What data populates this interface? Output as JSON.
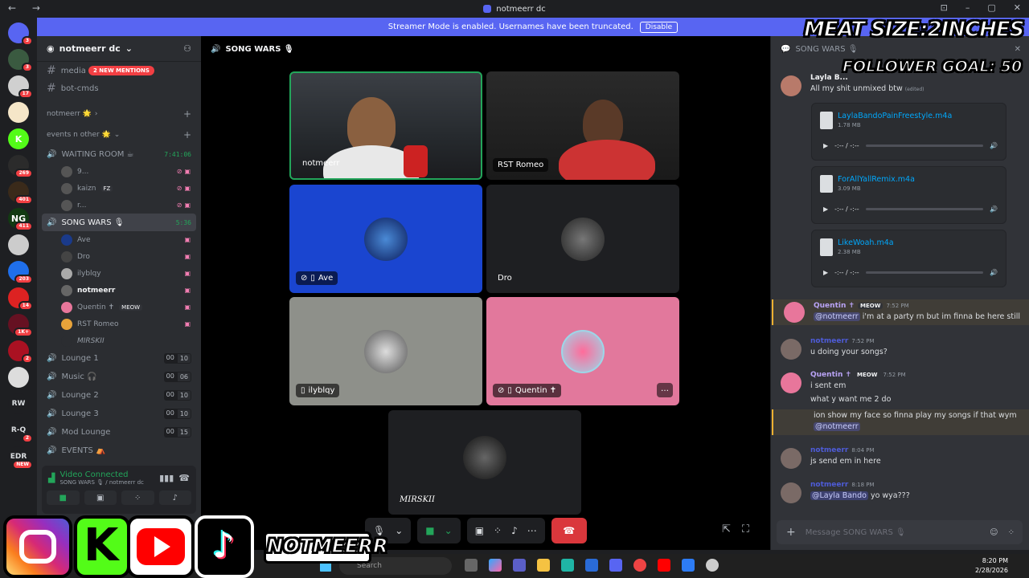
{
  "window": {
    "title": "notmeerr dc",
    "nav": "← →",
    "controls": [
      "⊡",
      "–",
      "▢",
      "✕"
    ]
  },
  "banner": {
    "text": "Streamer Mode is enabled. Usernames have been truncated.",
    "button": "Disable"
  },
  "servers": [
    {
      "label": "",
      "color": "#5865f2",
      "badge": "3"
    },
    {
      "label": "",
      "color": "#3a5a40",
      "badge": "3"
    },
    {
      "label": "",
      "color": "#d0d0d0",
      "badge": "17"
    },
    {
      "label": "",
      "color": "#f5e6c8",
      "badge": ""
    },
    {
      "label": "K",
      "color": "#53fc18",
      "badge": ""
    },
    {
      "label": "",
      "color": "#2b2b2b",
      "badge": "269"
    },
    {
      "label": "",
      "color": "#3a2a1a",
      "badge": "401"
    },
    {
      "label": "NG",
      "color": "#123a12",
      "badge": "411"
    },
    {
      "label": "",
      "color": "#cccccc",
      "badge": ""
    },
    {
      "label": "",
      "color": "#1f6feb",
      "badge": "203"
    },
    {
      "label": "",
      "color": "#d22",
      "badge": "14"
    },
    {
      "label": "",
      "color": "#612",
      "badge": "1K+"
    },
    {
      "label": "",
      "color": "#a12",
      "badge": "2"
    },
    {
      "label": "",
      "color": "#ddd",
      "badge": ""
    },
    {
      "label": "RW",
      "color": "#1e1f22",
      "badge": ""
    },
    {
      "label": "R-Q",
      "color": "#1e1f22",
      "badge": "2"
    },
    {
      "label": "EDR",
      "color": "#1e1f22",
      "badge": "NEW"
    }
  ],
  "guild": {
    "name": "notmeerr dc"
  },
  "channels": {
    "text": [
      {
        "name": "media"
      },
      {
        "name": "bot-cmds"
      }
    ],
    "mentions": "2 NEW MENTIONS",
    "cat1": "notmeerr 🌟",
    "cat2": "events n other 🌟",
    "waiting": {
      "name": "WAITING ROOM ☕",
      "time": "7:41:06"
    },
    "waiting_users": [
      {
        "name": "9...",
        "tag": ""
      },
      {
        "name": "kaizn",
        "tag": "FZ"
      },
      {
        "name": "r...",
        "tag": ""
      }
    ],
    "songwars": {
      "name": "SONG WARS 🎙",
      "time": "5:36"
    },
    "song_users": [
      {
        "name": "Ave",
        "tag": "",
        "color": "#1a3a8a"
      },
      {
        "name": "Dro",
        "tag": "",
        "color": "#444"
      },
      {
        "name": "ilyblqy",
        "tag": "",
        "color": "#aaa"
      },
      {
        "name": "notmeerr",
        "tag": "",
        "color": "#666"
      },
      {
        "name": "Quentin ✝",
        "tag": "MEOW",
        "color": "#e8769b"
      },
      {
        "name": "RST Romeo",
        "tag": "",
        "color": "#e8a33a"
      },
      {
        "name": "MIRSKII",
        "tag": "",
        "color": "#2b2d31"
      }
    ],
    "lounges": [
      {
        "name": "Lounge 1",
        "a": "00",
        "b": "10"
      },
      {
        "name": "Music 🎧",
        "a": "00",
        "b": "06"
      },
      {
        "name": "Lounge 2",
        "a": "00",
        "b": "10"
      },
      {
        "name": "Lounge 3",
        "a": "00",
        "b": "10"
      },
      {
        "name": "Mod Lounge",
        "a": "00",
        "b": "15"
      },
      {
        "name": "EVENTS ⛺",
        "a": "",
        "b": ""
      }
    ]
  },
  "voice": {
    "status": "Video Connected",
    "sub": "SONG WARS 🎙 / notmeerr dc"
  },
  "stage": {
    "title": "SONG WARS 🎙"
  },
  "tiles": [
    {
      "name": "notmeerr"
    },
    {
      "name": "RST Romeo"
    },
    {
      "name": "Ave"
    },
    {
      "name": "Dro"
    },
    {
      "name": "ilyblqy"
    },
    {
      "name": "Quentin ✝"
    },
    {
      "name": "MIRSKII"
    }
  ],
  "chat": {
    "header": "SONG WARS 🎙",
    "first_author": "Layla B...",
    "first_text": "All my shit unmixed btw",
    "edited": "(edited)",
    "attachments": [
      {
        "file": "LaylaBandoPainFreestyle.m4a",
        "size": "1.78 MB",
        "time": "-:-- / -:--"
      },
      {
        "file": "ForAllYallRemix.m4a",
        "size": "3.09 MB",
        "time": "-:-- / -:--"
      },
      {
        "file": "LikeWoah.m4a",
        "size": "2.38 MB",
        "time": "-:-- / -:--"
      }
    ],
    "messages": [
      {
        "author": "Quentin ✝",
        "tag": "MEOW",
        "time": "7:52 PM",
        "mention": "@notmeerr",
        "text": "i'm at a party rn but im finna be here still"
      },
      {
        "author": "notmeerr",
        "time": "7:52 PM",
        "text": "u doing your songs?"
      },
      {
        "author": "Quentin ✝",
        "tag": "MEOW",
        "time": "7:52 PM",
        "text": "i sent em",
        "text2": "what y want me 2 do",
        "text3": "ion show my face so finna play my songs if that wym",
        "mention": "@notmeerr"
      },
      {
        "author": "notmeerr",
        "time": "8:04 PM",
        "text": "js send em in here"
      },
      {
        "author": "notmeerr",
        "time": "8:18 PM",
        "mention": "@Layla Bando",
        "text": "yo wya???"
      }
    ],
    "placeholder": "Message SONG WARS 🎙"
  },
  "overlay": {
    "line1": "MEAT SIZE:2INCHES",
    "line2": "FOLLOWER GOAL: 50",
    "handle": "NOTMEERR"
  },
  "taskbar": {
    "search": "Search",
    "time": "8:20 PM",
    "date": "2/28/2026"
  }
}
